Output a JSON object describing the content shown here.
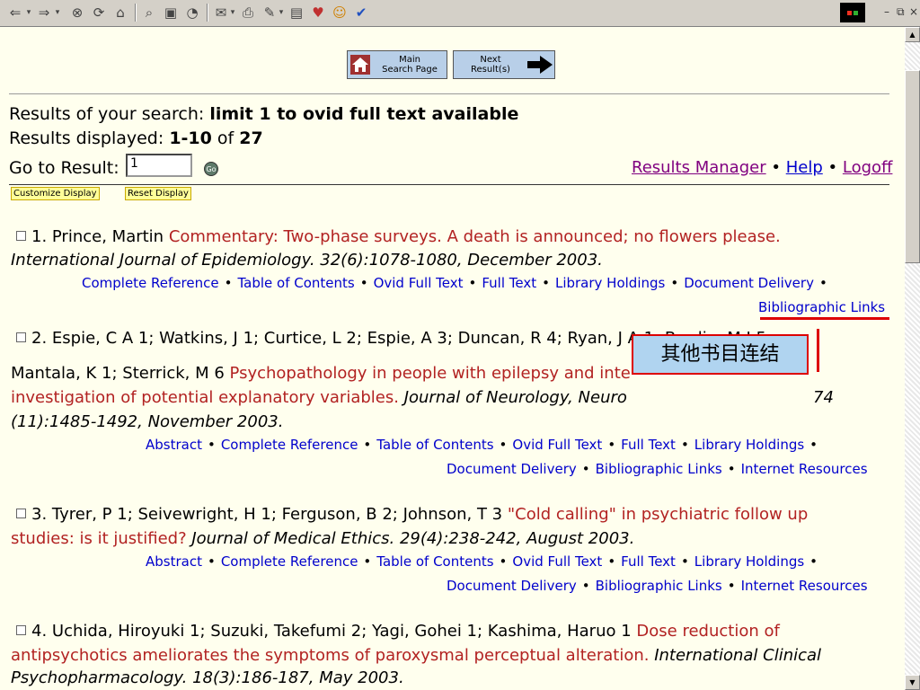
{
  "toolbar": {
    "icons": [
      "back-arrow-icon",
      "forward-arrow-icon",
      "stop-icon",
      "refresh-icon",
      "home-icon",
      "search-icon",
      "favorites-icon",
      "history-icon",
      "mail-icon",
      "print-icon",
      "edit-icon",
      "discuss-icon",
      "messenger-icon",
      "smiley-icon",
      "check-icon"
    ]
  },
  "nav": {
    "main_search_line1": "Main",
    "main_search_line2": "Search Page",
    "next_results_line1": "Next",
    "next_results_line2": "Result(s)"
  },
  "search": {
    "results_of_prefix": "Results of your search: ",
    "query": "limit 1 to ovid full text available",
    "displayed_prefix": "Results displayed: ",
    "displayed_range": "1-10",
    "displayed_of": " of ",
    "total": "27",
    "goto_label": "Go to Result:",
    "goto_value": "1",
    "go_label": "Go"
  },
  "top_links": {
    "results_manager": "Results Manager",
    "help": "Help",
    "logoff": "Logoff"
  },
  "display_buttons": {
    "customize": "Customize Display",
    "reset": "Reset Display"
  },
  "results": [
    {
      "authors": "1. Prince, Martin ",
      "title": "Commentary: Two-phase surveys. A death is announced; no flowers please.",
      "citation": "International Journal of Epidemiology. 32(6):1078-1080, December 2003.",
      "links_row1": [
        "Complete Reference",
        "Table of Contents",
        "Ovid Full Text",
        "Full Text",
        "Library Holdings",
        "Document Delivery"
      ],
      "links_row2": [
        "Bibliographic Links"
      ]
    },
    {
      "line1": "2. Espie, C A 1; Watkins, J 1; Curtice, L 2; Espie, A 3; Duncan, R 4; Ryan, J A 1; Brodie, M J 5;",
      "line2_authors": "Mantala, K 1; Sterrick, M 6 ",
      "line2_title": "Psychopathology in people with epilepsy and inte",
      "line3_title": "investigation of potential explanatory variables.",
      "line3_citation": " Journal of Neurology, Neuro",
      "line3_citation_end": "74",
      "line4_citation": "(11):1485-1492, November 2003.",
      "links_row1": [
        "Abstract",
        "Complete Reference",
        "Table of Contents",
        "Ovid Full Text",
        "Full Text",
        "Library Holdings"
      ],
      "links_row2": [
        "Document Delivery",
        "Bibliographic Links",
        "Internet Resources"
      ]
    },
    {
      "line1_authors": "3. Tyrer, P 1; Seivewright, H 1; Ferguson, B 2; Johnson, T 3 ",
      "line1_title": "\"Cold calling\" in psychiatric follow up",
      "line2_title": "studies: is it justified?",
      "line2_citation": " Journal of Medical Ethics. 29(4):238-242, August 2003.",
      "links_row1": [
        "Abstract",
        "Complete Reference",
        "Table of Contents",
        "Ovid Full Text",
        "Full Text",
        "Library Holdings"
      ],
      "links_row2": [
        "Document Delivery",
        "Bibliographic Links",
        "Internet Resources"
      ]
    },
    {
      "line1_authors": "4. Uchida, Hiroyuki 1; Suzuki, Takefumi 2; Yagi, Gohei 1; Kashima, Haruo 1 ",
      "line1_title": "Dose reduction of",
      "line2_title": "antipsychotics ameliorates the symptoms of paroxysmal perceptual alteration.",
      "line2_citation": " International Clinical",
      "line3_citation": "Psychopharmacology. 18(3):186-187, May 2003."
    }
  ],
  "annotation": {
    "label": "其他书目连结"
  },
  "colors": {
    "background": "#ffffee",
    "title_red": "#b22222",
    "link_blue": "#0000cc",
    "annotation_red": "#dd0000",
    "annotation_fill": "#b0d4f0"
  }
}
